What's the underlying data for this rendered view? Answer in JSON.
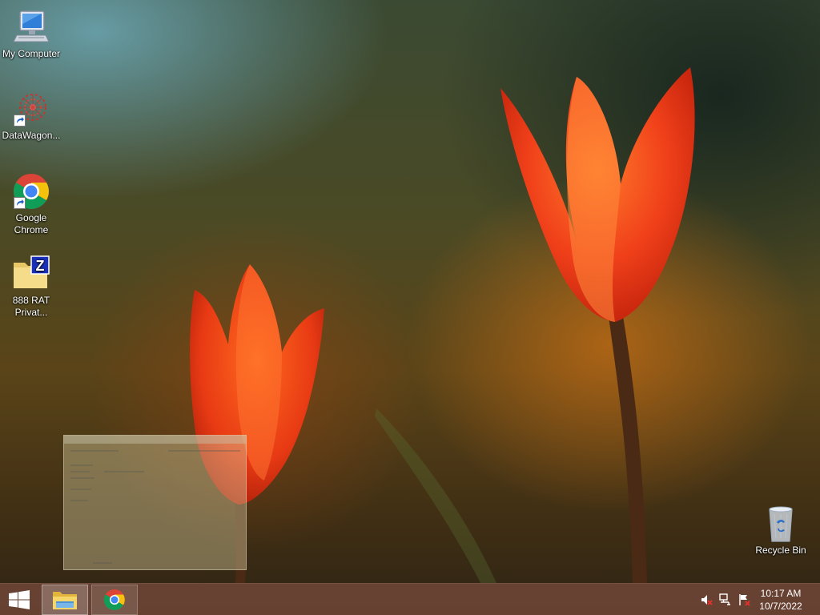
{
  "desktop": {
    "icons": [
      {
        "name": "my-computer",
        "label": "My Computer",
        "icon": "computer-icon"
      },
      {
        "name": "datawagon",
        "label": "DataWagon...",
        "icon": "datawagon-icon"
      },
      {
        "name": "google-chrome",
        "label": "Google Chrome",
        "icon": "chrome-icon"
      },
      {
        "name": "888-rat",
        "label": "888 RAT Privat...",
        "icon": "zip-folder-icon"
      },
      {
        "name": "recycle-bin",
        "label": "Recycle Bin",
        "icon": "recycle-bin-icon"
      }
    ]
  },
  "taskbar": {
    "start_icon": "windows-logo-icon",
    "pinned": [
      {
        "name": "file-explorer",
        "icon": "folder-icon"
      },
      {
        "name": "google-chrome",
        "icon": "chrome-icon"
      }
    ],
    "tray": {
      "icons": [
        "volume-muted-icon",
        "network-icon",
        "action-center-flag-icon"
      ],
      "time": "10:17 AM",
      "date": "10/7/2022"
    }
  },
  "colors": {
    "taskbar": "#6e4637",
    "tulip": "#ff4a10",
    "chrome_red": "#db4437",
    "chrome_yellow": "#f4c20d",
    "chrome_green": "#0f9d58",
    "chrome_blue": "#4285f4"
  }
}
